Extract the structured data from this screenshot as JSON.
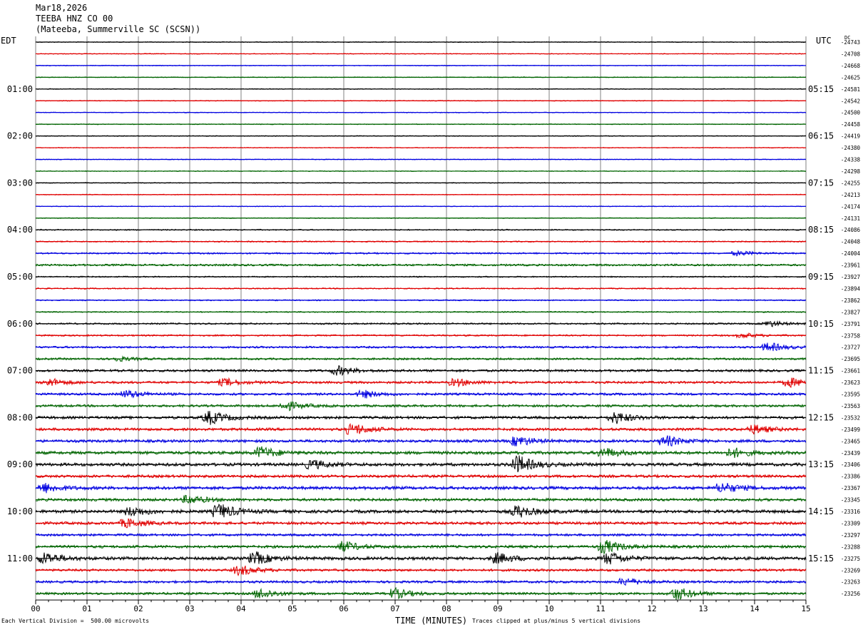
{
  "header": {
    "date": "Mar18,2026",
    "station": "TEEBA HNZ CO 00",
    "location": "(Mateeba, Summerville SC (SCSN))"
  },
  "left_axis_title": "EDT",
  "right_axis_title": "UTC",
  "dc_title": "DC",
  "footer": {
    "scale_note": "Each Vertical Division =  500.00 microvolts",
    "xlabel": "TIME (MINUTES)",
    "clip_note": "Traces clipped at plus/minus 5 vertical divisions"
  },
  "colors": {
    "trace_cycle": [
      "#000000",
      "#e00000",
      "#0000e0",
      "#006400"
    ],
    "grid": "#808080"
  },
  "chart_data": {
    "type": "line",
    "description_kind": "helicorder",
    "xlabel": "TIME (MINUTES)",
    "xlim": [
      0,
      15
    ],
    "x_ticks": [
      "00",
      "01",
      "02",
      "03",
      "04",
      "05",
      "06",
      "07",
      "08",
      "09",
      "10",
      "11",
      "12",
      "13",
      "14",
      "15"
    ],
    "rows_per_hour": 4,
    "row_minutes": 15,
    "left_hour_labels": [
      "01:00",
      "02:00",
      "03:00",
      "04:00",
      "05:00",
      "06:00",
      "07:00",
      "08:00",
      "09:00",
      "10:00",
      "11:00"
    ],
    "right_hour_labels": [
      "05:15",
      "06:15",
      "07:15",
      "08:15",
      "09:15",
      "10:15",
      "11:15",
      "12:15",
      "13:15",
      "14:15",
      "15:15"
    ],
    "dc_offsets": [
      "-24743",
      "-24708",
      "-24668",
      "-24625",
      "-24581",
      "-24542",
      "-24500",
      "-24458",
      "-24419",
      "-24380",
      "-24338",
      "-24298",
      "-24255",
      "-24213",
      "-24174",
      "-24131",
      "-24086",
      "-24048",
      "-24004",
      "-23961",
      "-23927",
      "-23894",
      "-23862",
      "-23827",
      "-23791",
      "-23758",
      "-23727",
      "-23695",
      "-23661",
      "-23623",
      "-23595",
      "-23563",
      "-23532",
      "-23499",
      "-23465",
      "-23439",
      "-23406",
      "-23386",
      "-23367",
      "-23345",
      "-23316",
      "-23309",
      "-23297",
      "-23288",
      "-23275",
      "-23269",
      "-23263",
      "-23256"
    ],
    "trace_noise": [
      1,
      1,
      1,
      1,
      1,
      1,
      1,
      1,
      1,
      1,
      1,
      1,
      1,
      1,
      1,
      1,
      1.5,
      1.5,
      2,
      2.5,
      1.5,
      1.5,
      1.5,
      1.5,
      2,
      2,
      2.5,
      2.5,
      3,
      3,
      3,
      3,
      3.5,
      3.5,
      3.5,
      4,
      4,
      3.5,
      4,
      3.5,
      4,
      3.5,
      3,
      3.5,
      4,
      3,
      3,
      3
    ],
    "events": [
      {
        "row": 18,
        "minute": 13.7,
        "amp": 3
      },
      {
        "row": 24,
        "minute": 14.3,
        "amp": 4
      },
      {
        "row": 25,
        "minute": 13.8,
        "amp": 3
      },
      {
        "row": 26,
        "minute": 14.3,
        "amp": 6
      },
      {
        "row": 27,
        "minute": 1.6,
        "amp": 3
      },
      {
        "row": 28,
        "minute": 5.9,
        "amp": 6
      },
      {
        "row": 29,
        "minute": 0.3,
        "amp": 5
      },
      {
        "row": 29,
        "minute": 3.7,
        "amp": 5
      },
      {
        "row": 29,
        "minute": 8.2,
        "amp": 5
      },
      {
        "row": 29,
        "minute": 14.7,
        "amp": 6
      },
      {
        "row": 30,
        "minute": 1.8,
        "amp": 5
      },
      {
        "row": 30,
        "minute": 6.4,
        "amp": 5
      },
      {
        "row": 31,
        "minute": 4.9,
        "amp": 6
      },
      {
        "row": 32,
        "minute": 3.4,
        "amp": 9
      },
      {
        "row": 32,
        "minute": 11.3,
        "amp": 8
      },
      {
        "row": 33,
        "minute": 6.2,
        "amp": 8
      },
      {
        "row": 33,
        "minute": 14.0,
        "amp": 6
      },
      {
        "row": 34,
        "minute": 9.4,
        "amp": 7
      },
      {
        "row": 34,
        "minute": 12.3,
        "amp": 7
      },
      {
        "row": 35,
        "minute": 4.4,
        "amp": 8
      },
      {
        "row": 35,
        "minute": 11.1,
        "amp": 6
      },
      {
        "row": 35,
        "minute": 13.6,
        "amp": 6
      },
      {
        "row": 36,
        "minute": 5.4,
        "amp": 6
      },
      {
        "row": 36,
        "minute": 9.4,
        "amp": 12
      },
      {
        "row": 38,
        "minute": 0.2,
        "amp": 6
      },
      {
        "row": 38,
        "minute": 13.4,
        "amp": 7
      },
      {
        "row": 39,
        "minute": 3.0,
        "amp": 6
      },
      {
        "row": 40,
        "minute": 1.9,
        "amp": 6
      },
      {
        "row": 40,
        "minute": 3.6,
        "amp": 10
      },
      {
        "row": 40,
        "minute": 9.4,
        "amp": 8
      },
      {
        "row": 41,
        "minute": 1.8,
        "amp": 6
      },
      {
        "row": 43,
        "minute": 6.0,
        "amp": 7
      },
      {
        "row": 43,
        "minute": 11.1,
        "amp": 9
      },
      {
        "row": 44,
        "minute": 0.2,
        "amp": 8
      },
      {
        "row": 44,
        "minute": 4.3,
        "amp": 8
      },
      {
        "row": 44,
        "minute": 9.0,
        "amp": 7
      },
      {
        "row": 44,
        "minute": 11.2,
        "amp": 8
      },
      {
        "row": 45,
        "minute": 4.0,
        "amp": 7
      },
      {
        "row": 46,
        "minute": 11.5,
        "amp": 5
      },
      {
        "row": 47,
        "minute": 4.4,
        "amp": 7
      },
      {
        "row": 47,
        "minute": 7.0,
        "amp": 7
      },
      {
        "row": 47,
        "minute": 12.5,
        "amp": 9
      }
    ]
  }
}
